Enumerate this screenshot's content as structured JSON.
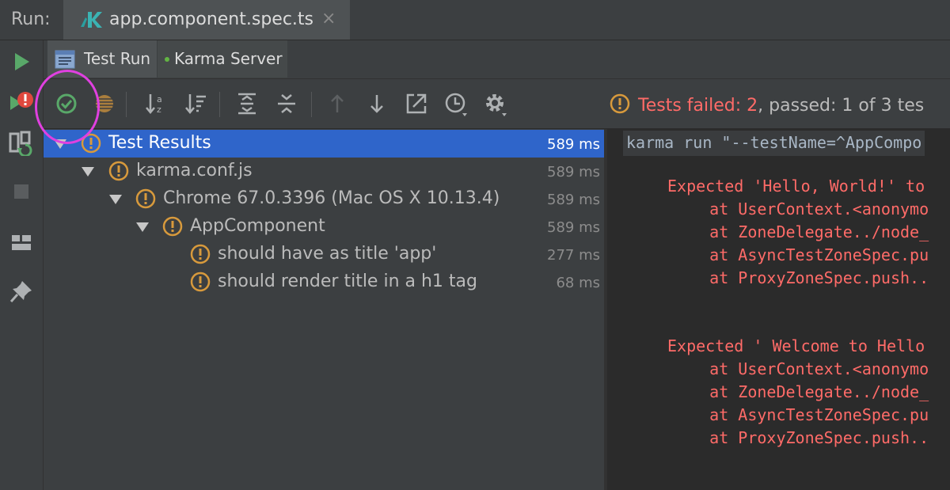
{
  "run_bar": {
    "label": "Run:",
    "tab_title": "app.component.spec.ts",
    "close_glyph": "×"
  },
  "sub_tabs": [
    {
      "label": "Test Run",
      "icon": "document-icon"
    },
    {
      "label": "Karma Server",
      "icon": "green-dot-icon"
    }
  ],
  "left_toolbar": [
    "run-icon",
    "rerun-failed-icon",
    "toggle-autotest-icon",
    "stop-icon",
    "layout-icon",
    "pin-icon"
  ],
  "actions": [
    "show-passed-icon",
    "show-ignored-icon",
    "sort-alpha-icon",
    "sort-duration-icon",
    "expand-all-icon",
    "collapse-all-icon",
    "prev-failed-icon",
    "next-failed-icon",
    "export-icon",
    "history-icon",
    "settings-icon"
  ],
  "summary": {
    "failed_text": "Tests failed: 2",
    "rest_text": ", passed: 1 of 3 tes",
    "failed_color": "#ff6b68"
  },
  "tree": [
    {
      "name": "Test Results",
      "time": "589 ms",
      "level": 0,
      "expanded": true,
      "selected": true
    },
    {
      "name": "karma.conf.js",
      "time": "589 ms",
      "level": 1,
      "expanded": true
    },
    {
      "name": "Chrome 67.0.3396 (Mac OS X 10.13.4)",
      "time": "589 ms",
      "level": 2,
      "expanded": true
    },
    {
      "name": "AppComponent",
      "time": "589 ms",
      "level": 3,
      "expanded": true
    },
    {
      "name": "should have as title 'app'",
      "time": "277 ms",
      "level": 4
    },
    {
      "name": "should render title in a h1 tag",
      "time": "68 ms",
      "level": 4
    }
  ],
  "console": {
    "command": "karma run \"--testName=^AppCompo",
    "lines": [
      "Expected 'Hello, World!' to",
      "    at UserContext.<anonymo",
      "    at ZoneDelegate../node_",
      "    at AsyncTestZoneSpec.pu",
      "    at ProxyZoneSpec.push..",
      "Expected ' Welcome to Hello",
      "    at UserContext.<anonymo",
      "    at ZoneDelegate../node_",
      "    at AsyncTestZoneSpec.pu",
      "    at ProxyZoneSpec.push.."
    ],
    "error_color": "#ff6b68"
  },
  "colors": {
    "warning": "#d89a3c",
    "selection": "#2f65ca",
    "success": "#62b543",
    "highlight_ring": "#e040e0"
  }
}
